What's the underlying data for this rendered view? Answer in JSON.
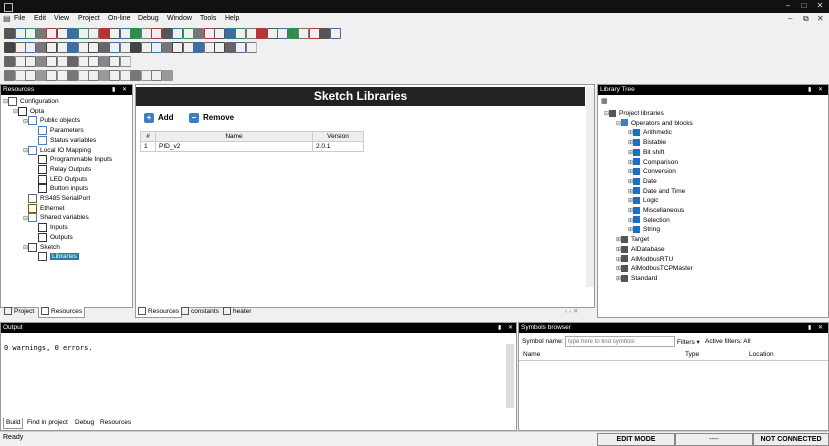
{
  "window": {
    "minimize": "–",
    "maximize": "□",
    "close": "✕"
  },
  "menu": [
    "File",
    "Edit",
    "View",
    "Project",
    "On-line",
    "Debug",
    "Window",
    "Tools",
    "Help"
  ],
  "mdi_controls": {
    "minimize": "–",
    "restore": "⧉",
    "close": "✕"
  },
  "resources": {
    "title": "Resources",
    "tree": [
      {
        "label": "Configuration",
        "depth": 0,
        "exp": "⊟",
        "icon": "config-icon"
      },
      {
        "label": "Opta",
        "depth": 1,
        "exp": "⊟",
        "icon": "device-icon"
      },
      {
        "label": "Public objects",
        "depth": 2,
        "exp": "⊟",
        "icon": "folder-icon"
      },
      {
        "label": "Parameters",
        "depth": 3,
        "exp": "",
        "icon": "grid-icon"
      },
      {
        "label": "Status variables",
        "depth": 3,
        "exp": "",
        "icon": "grid-icon"
      },
      {
        "label": "Local IO Mapping",
        "depth": 2,
        "exp": "⊟",
        "icon": "folder-icon"
      },
      {
        "label": "Programmable Inputs",
        "depth": 3,
        "exp": "",
        "icon": "io-icon"
      },
      {
        "label": "Relay Outputs",
        "depth": 3,
        "exp": "",
        "icon": "io-icon"
      },
      {
        "label": "LED Outputs",
        "depth": 3,
        "exp": "",
        "icon": "io-icon"
      },
      {
        "label": "Button inputs",
        "depth": 3,
        "exp": "",
        "icon": "io-icon"
      },
      {
        "label": "RS485 SerialPort",
        "depth": 2,
        "exp": "",
        "icon": "serial-icon"
      },
      {
        "label": "Ethernet",
        "depth": 2,
        "exp": "",
        "icon": "ethernet-icon"
      },
      {
        "label": "Shared variables",
        "depth": 2,
        "exp": "⊟",
        "icon": "folder-icon"
      },
      {
        "label": "Inputs",
        "depth": 3,
        "exp": "",
        "icon": "io-icon"
      },
      {
        "label": "Outputs",
        "depth": 3,
        "exp": "",
        "icon": "io-icon"
      },
      {
        "label": "Sketch",
        "depth": 2,
        "exp": "⊟",
        "icon": "sketch-icon"
      },
      {
        "label": "Libraries",
        "depth": 3,
        "exp": "",
        "icon": "sketch-icon",
        "selected": true
      }
    ],
    "tabs": [
      "Project",
      "Resources"
    ]
  },
  "editor": {
    "title": "Sketch Libraries",
    "add_label": "Add",
    "remove_label": "Remove",
    "columns": [
      "#",
      "Name",
      "Version"
    ],
    "rows": [
      {
        "num": "1",
        "name": "PID_v2",
        "version": "2.0.1"
      }
    ],
    "tabs": [
      "Resources",
      "constants",
      "heater"
    ],
    "nav": "‹ › ✕"
  },
  "library_tree": {
    "title": "Library Tree",
    "root": "Project libraries",
    "group": "Operators and blocks",
    "items": [
      "Arithmetic",
      "Bistable",
      "Bit shift",
      "Comparison",
      "Conversion",
      "Date",
      "Date and Time",
      "Logic",
      "Miscellaneous",
      "Selection",
      "String"
    ],
    "others": [
      "Target",
      "AlDatabase",
      "AlModbusRTU",
      "AlModbusTCPMaster",
      "Standard"
    ]
  },
  "output": {
    "title": "Output",
    "text": "0 warnings, 0 errors.",
    "tabs": [
      "Build",
      "Find in project",
      "Debug",
      "Resources"
    ]
  },
  "symbols": {
    "title": "Symbols browser",
    "name_label": "Symbol name:",
    "placeholder": "type here to find symbols",
    "filters": "Filters ▾",
    "active_filters": "Active filters: All",
    "columns": [
      "Name",
      "Type",
      "Location"
    ]
  },
  "status": {
    "left": "Ready",
    "mode": "EDIT MODE",
    "mid": "----",
    "conn": "NOT CONNECTED"
  },
  "colors": {
    "accent": "#3d7fbf",
    "selected": "#1e7fa8",
    "titlebar": "#111111"
  }
}
